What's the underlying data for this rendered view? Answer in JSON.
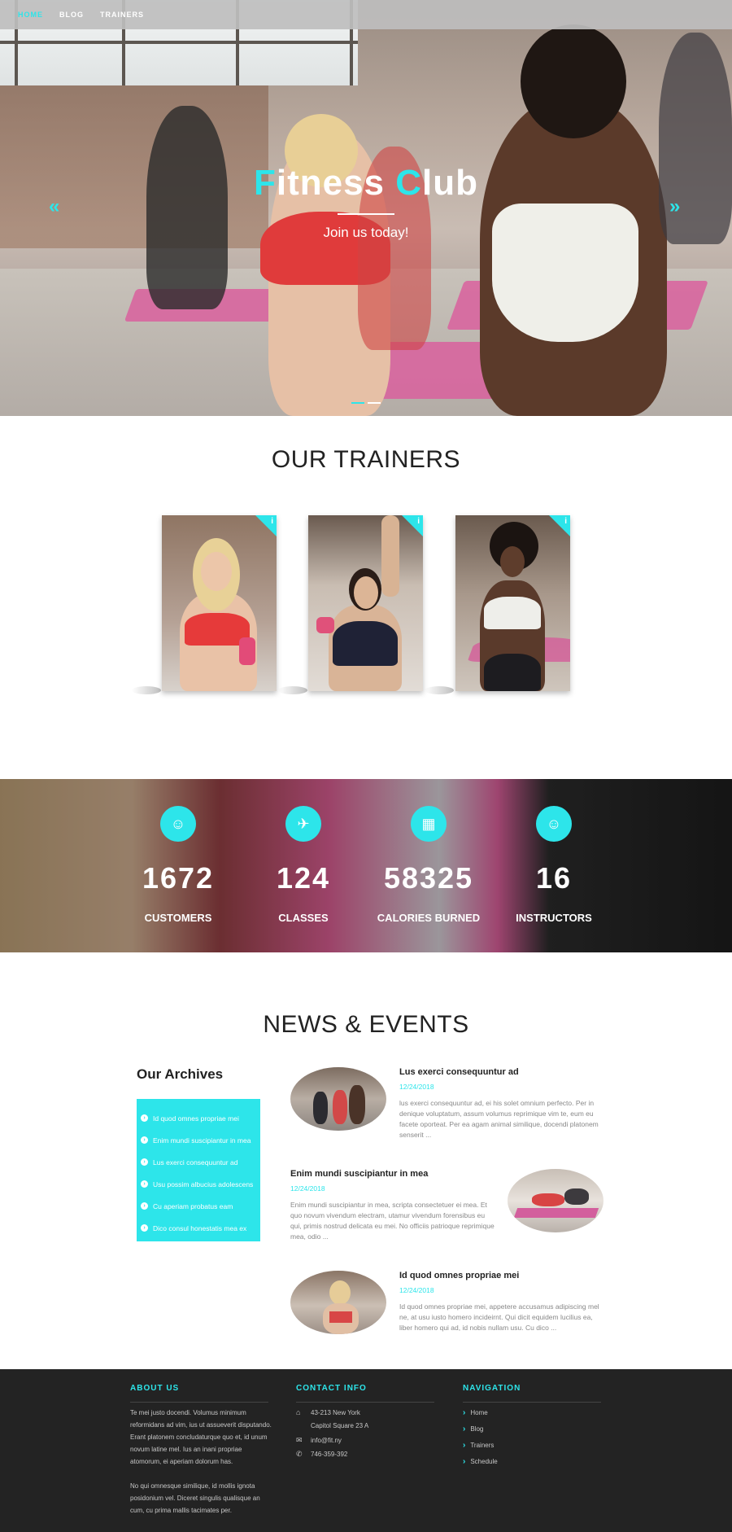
{
  "nav": {
    "items": [
      "HOME",
      "BLOG",
      "TRAINERS"
    ],
    "active": 0
  },
  "hero": {
    "title_first_letter": "F",
    "title_word1_rest": "itness ",
    "title_second_letter": "C",
    "title_word2_rest": "lub",
    "subtitle": "Join us today!",
    "prev_arrow": "«",
    "next_arrow": "»"
  },
  "trainers": {
    "title": "OUR TRAINERS",
    "info_glyph": "i"
  },
  "stats": [
    {
      "icon": "users-icon",
      "glyph": "☺",
      "value": "1672",
      "label": "CUSTOMERS"
    },
    {
      "icon": "runner-icon",
      "glyph": "✈",
      "value": "124",
      "label": "CLASSES"
    },
    {
      "icon": "calories-icon",
      "glyph": "▦",
      "value": "58325",
      "label": "CALORIES BURNED"
    },
    {
      "icon": "instructors-icon",
      "glyph": "☺",
      "value": "16",
      "label": "INSTRUCTORS"
    }
  ],
  "news": {
    "title": "NEWS & EVENTS",
    "archives_title": "Our Archives",
    "archives": [
      "Id quod omnes propriae mei",
      "Enim mundi suscipiantur in mea",
      "Lus exerci consequuntur ad",
      "Usu possim albucius adolescens",
      "Cu aperiam probatus eam",
      "Dico consul honestatis mea ex"
    ],
    "posts": [
      {
        "title": "Lus exerci consequuntur ad",
        "date": "12/24/2018",
        "text": "lus exerci consequuntur ad, ei his solet omnium perfecto. Per in denique voluptatum, assum volumus reprimique vim te, eum eu facete oporteat. Per ea agam animal similique, docendi platonem senserit ..."
      },
      {
        "title": "Enim mundi suscipiantur in mea",
        "date": "12/24/2018",
        "text": "Enim mundi suscipiantur in mea, scripta consectetuer ei mea. Et quo novum vivendum electram, utamur vivendum forensibus eu qui, primis nostrud delicata eu mei. No officiis patrioque reprimique mea, odio ..."
      },
      {
        "title": "Id quod omnes propriae mei",
        "date": "12/24/2018",
        "text": "Id quod omnes propriae mei, appetere accusamus adipiscing mel ne, at usu iusto homero incideirnt. Qui dicit equidem lucilius ea, liber homero qui ad, id nobis nullam usu. Cu dico ..."
      }
    ]
  },
  "footer": {
    "about": {
      "heading": "ABOUT US",
      "p1": "Te mei justo docendi. Volumus minimum reformidans ad vim, ius ut assueverit disputando. Erant platonem concludaturque quo et, id unum novum latine mel. Ius an inani propriae atomorum, ei aperiam dolorum has.",
      "p2": "No qui omnesque similique, id mollis ignota posidonium vel. Diceret singulis qualisque an cum, cu prima mallis tacimates per."
    },
    "contact": {
      "heading": "CONTACT INFO",
      "address1": "43-213 New York",
      "address2": "Capitol Square 23 A",
      "email": "info@fit.ny",
      "phone": "746-359-392"
    },
    "navigation": {
      "heading": "NAVIGATION",
      "items": [
        "Home",
        "Blog",
        "Trainers",
        "Schedule"
      ]
    }
  },
  "colors": {
    "accent": "#2de5ea",
    "footer_bg": "#232323"
  }
}
